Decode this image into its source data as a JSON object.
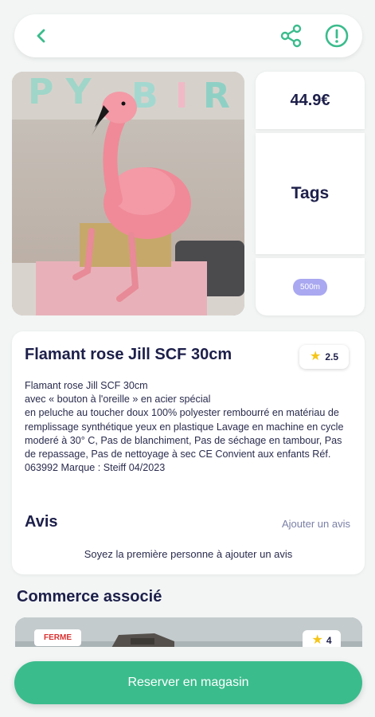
{
  "colors": {
    "accent": "#3bbc8d",
    "navy": "#1d1f4a",
    "closed": "#d9302f",
    "distance_badge": "#a9a8f0"
  },
  "topbar": {
    "back_icon": "chevron-left-icon",
    "share_icon": "share-icon",
    "report_icon": "alert-circle-icon"
  },
  "product": {
    "price": "44.9€",
    "tags_label": "Tags",
    "distance": "500m",
    "title": "Flamant rose Jill SCF 30cm",
    "rating": "2.5",
    "description": "Flamant rose Jill SCF 30cm\navec «  bouton à l'oreille »  en acier spécial\nen peluche au toucher doux 100% polyester rembourré en matériau de remplissage synthétique yeux en plastique Lavage en machine en cycle moderé à 30° C, Pas de blanchiment, Pas de séchage en tambour, Pas de repassage, Pas de nettoyage à sec CE Convient aux enfants Réf. 063992 Marque : Steiff 04/2023"
  },
  "reviews": {
    "title": "Avis",
    "add_label": "Ajouter un avis",
    "empty_text": "Soyez la première personne à ajouter un avis"
  },
  "store": {
    "section_title": "Commerce associé",
    "status": "FERME",
    "rating": "4"
  },
  "cta": {
    "label": "Reserver en magasin"
  }
}
